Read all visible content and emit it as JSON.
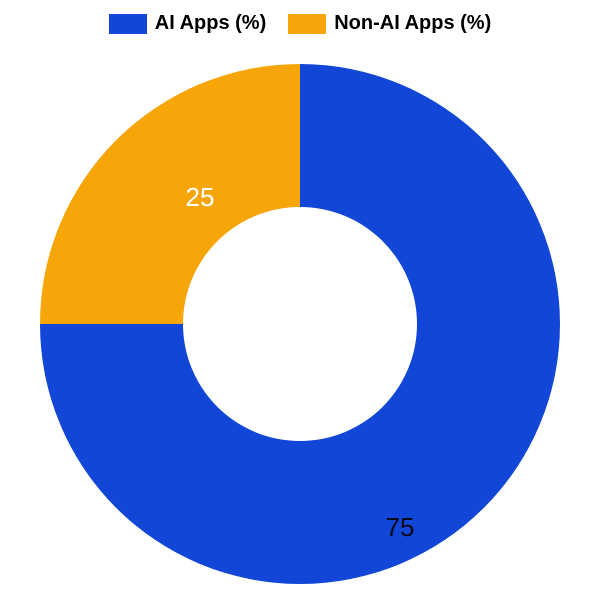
{
  "chart_data": {
    "type": "pie",
    "series": [
      {
        "name": "AI Apps (%)",
        "value": 75,
        "color": "#1146d6"
      },
      {
        "name": "Non-AI Apps (%)",
        "value": 25,
        "color": "#f6a609"
      }
    ],
    "inner_radius_ratio": 0.45,
    "start_angle_deg": 90,
    "direction": "clockwise"
  },
  "legend": {
    "items": [
      {
        "label": "AI Apps (%)"
      },
      {
        "label": "Non-AI Apps (%)"
      }
    ]
  },
  "labels": {
    "slice_0": "75",
    "slice_1": "25"
  }
}
